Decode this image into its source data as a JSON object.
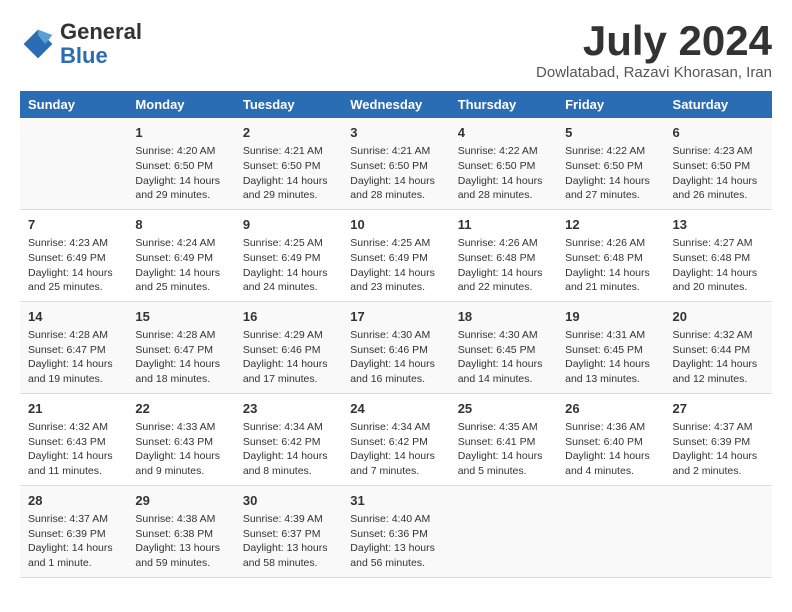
{
  "header": {
    "logo_general": "General",
    "logo_blue": "Blue",
    "month_title": "July 2024",
    "location": "Dowlatabad, Razavi Khorasan, Iran"
  },
  "weekdays": [
    "Sunday",
    "Monday",
    "Tuesday",
    "Wednesday",
    "Thursday",
    "Friday",
    "Saturday"
  ],
  "weeks": [
    [
      {
        "day": "",
        "info": ""
      },
      {
        "day": "1",
        "info": "Sunrise: 4:20 AM\nSunset: 6:50 PM\nDaylight: 14 hours\nand 29 minutes."
      },
      {
        "day": "2",
        "info": "Sunrise: 4:21 AM\nSunset: 6:50 PM\nDaylight: 14 hours\nand 29 minutes."
      },
      {
        "day": "3",
        "info": "Sunrise: 4:21 AM\nSunset: 6:50 PM\nDaylight: 14 hours\nand 28 minutes."
      },
      {
        "day": "4",
        "info": "Sunrise: 4:22 AM\nSunset: 6:50 PM\nDaylight: 14 hours\nand 28 minutes."
      },
      {
        "day": "5",
        "info": "Sunrise: 4:22 AM\nSunset: 6:50 PM\nDaylight: 14 hours\nand 27 minutes."
      },
      {
        "day": "6",
        "info": "Sunrise: 4:23 AM\nSunset: 6:50 PM\nDaylight: 14 hours\nand 26 minutes."
      }
    ],
    [
      {
        "day": "7",
        "info": "Sunrise: 4:23 AM\nSunset: 6:49 PM\nDaylight: 14 hours\nand 25 minutes."
      },
      {
        "day": "8",
        "info": "Sunrise: 4:24 AM\nSunset: 6:49 PM\nDaylight: 14 hours\nand 25 minutes."
      },
      {
        "day": "9",
        "info": "Sunrise: 4:25 AM\nSunset: 6:49 PM\nDaylight: 14 hours\nand 24 minutes."
      },
      {
        "day": "10",
        "info": "Sunrise: 4:25 AM\nSunset: 6:49 PM\nDaylight: 14 hours\nand 23 minutes."
      },
      {
        "day": "11",
        "info": "Sunrise: 4:26 AM\nSunset: 6:48 PM\nDaylight: 14 hours\nand 22 minutes."
      },
      {
        "day": "12",
        "info": "Sunrise: 4:26 AM\nSunset: 6:48 PM\nDaylight: 14 hours\nand 21 minutes."
      },
      {
        "day": "13",
        "info": "Sunrise: 4:27 AM\nSunset: 6:48 PM\nDaylight: 14 hours\nand 20 minutes."
      }
    ],
    [
      {
        "day": "14",
        "info": "Sunrise: 4:28 AM\nSunset: 6:47 PM\nDaylight: 14 hours\nand 19 minutes."
      },
      {
        "day": "15",
        "info": "Sunrise: 4:28 AM\nSunset: 6:47 PM\nDaylight: 14 hours\nand 18 minutes."
      },
      {
        "day": "16",
        "info": "Sunrise: 4:29 AM\nSunset: 6:46 PM\nDaylight: 14 hours\nand 17 minutes."
      },
      {
        "day": "17",
        "info": "Sunrise: 4:30 AM\nSunset: 6:46 PM\nDaylight: 14 hours\nand 16 minutes."
      },
      {
        "day": "18",
        "info": "Sunrise: 4:30 AM\nSunset: 6:45 PM\nDaylight: 14 hours\nand 14 minutes."
      },
      {
        "day": "19",
        "info": "Sunrise: 4:31 AM\nSunset: 6:45 PM\nDaylight: 14 hours\nand 13 minutes."
      },
      {
        "day": "20",
        "info": "Sunrise: 4:32 AM\nSunset: 6:44 PM\nDaylight: 14 hours\nand 12 minutes."
      }
    ],
    [
      {
        "day": "21",
        "info": "Sunrise: 4:32 AM\nSunset: 6:43 PM\nDaylight: 14 hours\nand 11 minutes."
      },
      {
        "day": "22",
        "info": "Sunrise: 4:33 AM\nSunset: 6:43 PM\nDaylight: 14 hours\nand 9 minutes."
      },
      {
        "day": "23",
        "info": "Sunrise: 4:34 AM\nSunset: 6:42 PM\nDaylight: 14 hours\nand 8 minutes."
      },
      {
        "day": "24",
        "info": "Sunrise: 4:34 AM\nSunset: 6:42 PM\nDaylight: 14 hours\nand 7 minutes."
      },
      {
        "day": "25",
        "info": "Sunrise: 4:35 AM\nSunset: 6:41 PM\nDaylight: 14 hours\nand 5 minutes."
      },
      {
        "day": "26",
        "info": "Sunrise: 4:36 AM\nSunset: 6:40 PM\nDaylight: 14 hours\nand 4 minutes."
      },
      {
        "day": "27",
        "info": "Sunrise: 4:37 AM\nSunset: 6:39 PM\nDaylight: 14 hours\nand 2 minutes."
      }
    ],
    [
      {
        "day": "28",
        "info": "Sunrise: 4:37 AM\nSunset: 6:39 PM\nDaylight: 14 hours\nand 1 minute."
      },
      {
        "day": "29",
        "info": "Sunrise: 4:38 AM\nSunset: 6:38 PM\nDaylight: 13 hours\nand 59 minutes."
      },
      {
        "day": "30",
        "info": "Sunrise: 4:39 AM\nSunset: 6:37 PM\nDaylight: 13 hours\nand 58 minutes."
      },
      {
        "day": "31",
        "info": "Sunrise: 4:40 AM\nSunset: 6:36 PM\nDaylight: 13 hours\nand 56 minutes."
      },
      {
        "day": "",
        "info": ""
      },
      {
        "day": "",
        "info": ""
      },
      {
        "day": "",
        "info": ""
      }
    ]
  ]
}
